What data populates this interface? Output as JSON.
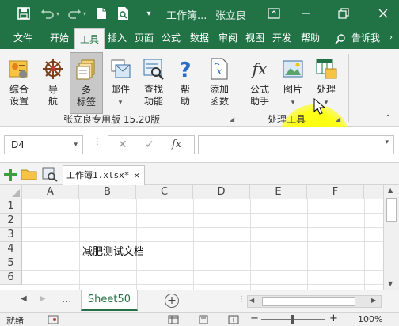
{
  "title_bar": {
    "document": "工作簿...",
    "user": "张立良",
    "icons": [
      "save-icon",
      "undo-icon",
      "redo-icon",
      "new-doc-icon",
      "print-preview-icon",
      "ribbon-options-icon",
      "minimize-icon",
      "restore-icon"
    ]
  },
  "tabs": [
    "文件",
    "开始",
    "工具",
    "插入",
    "页面",
    "公式",
    "数据",
    "审阅",
    "视图",
    "开发",
    "帮助"
  ],
  "active_tab": "工具",
  "tell_me": "告诉我",
  "ribbon": {
    "group1": {
      "name": "张立良专用版 15.20版",
      "buttons": [
        {
          "label_1": "综合",
          "label_2": "设置",
          "icon": "settings-icon"
        },
        {
          "label_1": "导",
          "label_2": "航",
          "icon": "compass-icon"
        },
        {
          "label_1": "多",
          "label_2": "标签",
          "icon": "multi-tab-icon"
        },
        {
          "label_1": "邮件",
          "label_2": "",
          "icon": "mail-icon"
        },
        {
          "label_1": "查找",
          "label_2": "功能",
          "icon": "find-function-icon"
        },
        {
          "label_1": "帮",
          "label_2": "助",
          "icon": "help-icon"
        },
        {
          "label_1": "添加",
          "label_2": "函数",
          "icon": "add-function-icon"
        }
      ]
    },
    "group2": {
      "name": "处理工具",
      "buttons": [
        {
          "label_1": "公式",
          "label_2": "助手",
          "icon": "fx-icon"
        },
        {
          "label_1": "图片",
          "label_2": "",
          "icon": "picture-icon"
        },
        {
          "label_1": "处理",
          "label_2": "",
          "icon": "process-icon"
        }
      ]
    }
  },
  "formula_bar": {
    "name_box": "D4",
    "cancel": "✕",
    "enter": "✓",
    "fx": "fx",
    "value": ""
  },
  "workbook_tab": {
    "label": "工作簿1.xlsx*",
    "close": "✕"
  },
  "grid": {
    "columns": [
      "A",
      "B",
      "C",
      "D",
      "E",
      "F"
    ],
    "rows": [
      "1",
      "2",
      "3",
      "4",
      "5",
      "6"
    ],
    "cells": [
      {
        "ref": "B4",
        "value": "减肥测试文档"
      }
    ]
  },
  "sheets": {
    "ellipsis": "...",
    "active": "Sheet50",
    "add": "+"
  },
  "status_bar": {
    "mode": "就绪",
    "zoom": "100%",
    "zoom_minus": "−",
    "zoom_plus": "+"
  },
  "colors": {
    "accent": "#217346",
    "ribbon_bg": "#f3f3f3",
    "highlight": "#ffff00"
  }
}
